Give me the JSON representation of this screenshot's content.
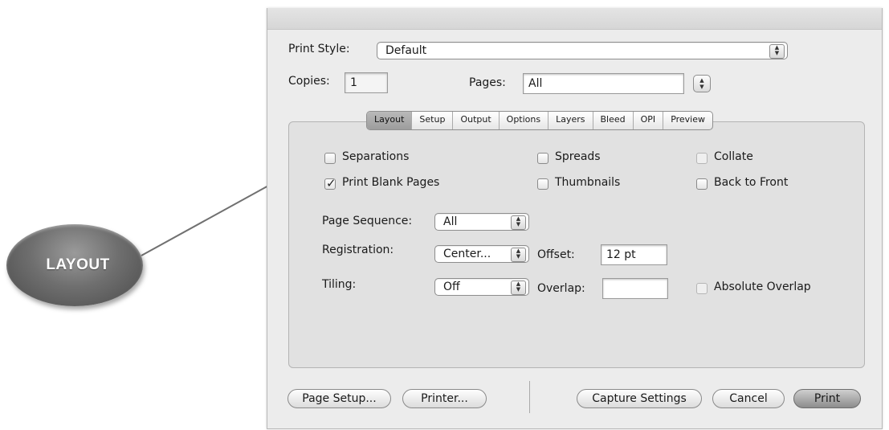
{
  "callout": {
    "label": "LAYOUT"
  },
  "top": {
    "print_style_label": "Print Style:",
    "print_style_value": "Default",
    "copies_label": "Copies:",
    "copies_value": "1",
    "pages_label": "Pages:",
    "pages_value": "All"
  },
  "tabs": [
    "Layout",
    "Setup",
    "Output",
    "Options",
    "Layers",
    "Bleed",
    "OPI",
    "Preview"
  ],
  "active_tab": "Layout",
  "checkboxes": {
    "separations": {
      "label": "Separations",
      "checked": false
    },
    "spreads": {
      "label": "Spreads",
      "checked": false
    },
    "collate": {
      "label": "Collate",
      "checked": false,
      "enabled": false
    },
    "print_blank_pages": {
      "label": "Print Blank Pages",
      "checked": true
    },
    "thumbnails": {
      "label": "Thumbnails",
      "checked": false
    },
    "back_to_front": {
      "label": "Back to Front",
      "checked": false
    },
    "absolute_overlap": {
      "label": "Absolute Overlap",
      "checked": false,
      "enabled": false
    }
  },
  "fields": {
    "page_sequence_label": "Page Sequence:",
    "page_sequence_value": "All",
    "registration_label": "Registration:",
    "registration_value": "Center...",
    "offset_label": "Offset:",
    "offset_value": "12 pt",
    "tiling_label": "Tiling:",
    "tiling_value": "Off",
    "overlap_label": "Overlap:",
    "overlap_value": ""
  },
  "buttons": {
    "page_setup": "Page Setup...",
    "printer": "Printer...",
    "capture_settings": "Capture Settings",
    "cancel": "Cancel",
    "print": "Print"
  },
  "icons": {
    "stepper": "up-down-arrows-icon",
    "checkmark": "checkmark-icon"
  }
}
